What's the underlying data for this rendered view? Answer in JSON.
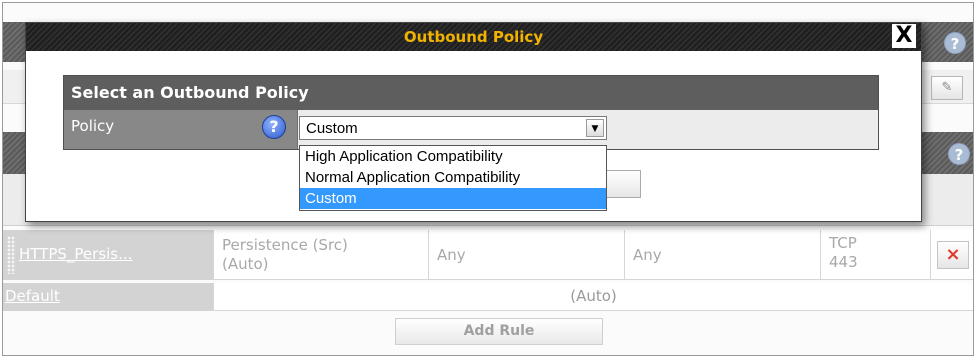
{
  "modal": {
    "title": "Outbound Policy",
    "close_label": "X",
    "section_header": "Select an Outbound Policy",
    "policy_label": "Policy",
    "help_label": "?",
    "select": {
      "current_value": "Custom",
      "options": [
        {
          "label": "High Application Compatibility",
          "selected": false
        },
        {
          "label": "Normal Application Compatibility",
          "selected": false
        },
        {
          "label": "Custom",
          "selected": true
        }
      ]
    }
  },
  "background": {
    "help_label": "?",
    "rule": {
      "name": "HTTPS_Persis...",
      "type_line1": "Persistence (Src)",
      "type_line2": "(Auto)",
      "source": "Any",
      "destination": "Any",
      "proto_line1": "TCP",
      "proto_line2": "443",
      "delete_label": "×"
    },
    "default_rule": {
      "name": "Default",
      "value": "(Auto)"
    },
    "add_rule_label": "Add Rule"
  },
  "colors": {
    "title_accent": "#f2b300",
    "selected_option_bg": "#3399ff",
    "delete_icon": "#e03a2c"
  }
}
